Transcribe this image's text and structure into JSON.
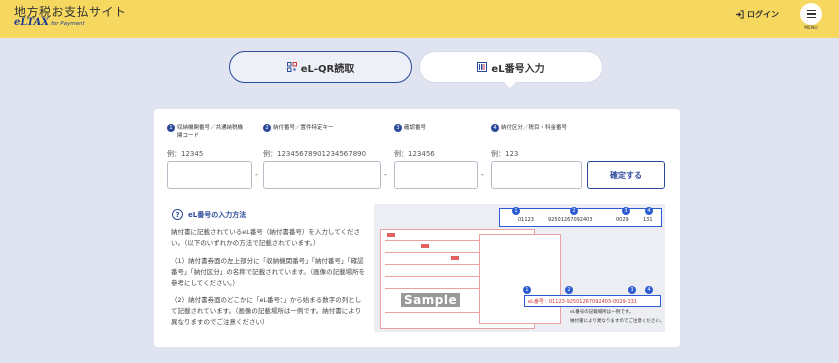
{
  "header": {
    "site_title": "地方税お支払サイト",
    "logo_main": "eLTAX",
    "logo_sub": "for Payment",
    "login_label": "ログイン",
    "menu_label": "MENU"
  },
  "tabs": [
    {
      "label": "eL-QR読取",
      "icon": "qr-code-icon",
      "active": false
    },
    {
      "label": "eL番号入力",
      "icon": "barcode-icon",
      "active": true
    }
  ],
  "fields": [
    {
      "num": "1",
      "label": "収納機関番号／共通納税機関コード",
      "example": "例：12345"
    },
    {
      "num": "2",
      "label": "納付番号／置件特定キー",
      "example": "例：12345678901234567890"
    },
    {
      "num": "3",
      "label": "確認番号",
      "example": "例：123456"
    },
    {
      "num": "4",
      "label": "納付区分／税目・科金番号",
      "example": "例：123"
    }
  ],
  "separator": "-",
  "confirm_label": "確定する",
  "howto": {
    "title": "eL番号の入力方法",
    "p1": "納付書に記載されているeL番号（納付書番号）を入力してください。（以下のいずれかの方法で記載されています。）",
    "p2": "（1）納付書券面の左上部分に「収納機関番号」「納付番号」「確認番号」「納付区分」の名称で記載されています。（画像の記載場所を参考にしてください。）",
    "p3": "（2）納付書券面のどこかに「eL番号：」から始まる数字の列として記載されています。（画像の記載場所は一例です。納付書により異なりますのでご注意ください）"
  },
  "sample_image": {
    "stamp": "Sample",
    "callout1_values": [
      "01123",
      "92501267092403",
      "0029",
      "131"
    ],
    "callout2_text": "eL番号：01123-92501267092403-0029-131",
    "note1": "eL番号の記載場所は一例です。",
    "note2": "納付書により異なりますのでご注意ください。"
  },
  "colors": {
    "header": "#f6d860",
    "accent": "#2b4a9a",
    "background": "#dfe4f0"
  }
}
